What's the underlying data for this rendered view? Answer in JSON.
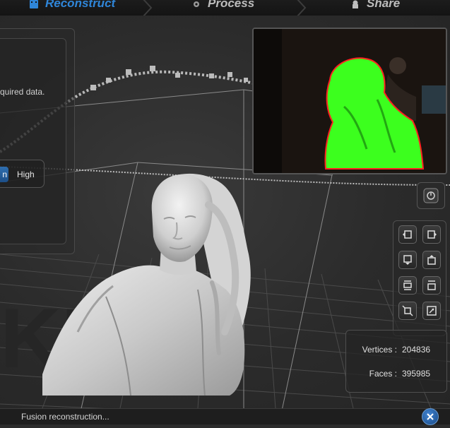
{
  "tabs": [
    {
      "label": "Reconstruct",
      "icon": "film-icon",
      "active": true
    },
    {
      "label": "Process",
      "icon": "gear-icon",
      "active": false
    },
    {
      "label": "Share",
      "icon": "share-icon",
      "active": false
    }
  ],
  "settings_panel": {
    "info_text": "quired data.",
    "quality_low_label": "n",
    "quality_high_label": "High"
  },
  "stats": {
    "vertices_label": "Vertices :",
    "vertices_value": "204836",
    "faces_label": "Faces :",
    "faces_value": "395985"
  },
  "status": {
    "text": "Fusion reconstruction..."
  },
  "colors": {
    "accent": "#2f86d9",
    "mesh_overlay": "#3cff1e",
    "edge_highlight": "#ff2020"
  }
}
